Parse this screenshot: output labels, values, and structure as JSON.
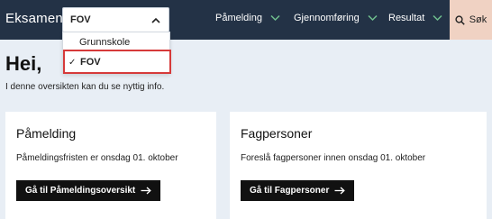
{
  "header": {
    "brand": "Eksamen",
    "select": {
      "value": "FOV"
    },
    "nav": [
      {
        "label": "Påmelding"
      },
      {
        "label": "Gjennomføring"
      },
      {
        "label": "Resultat"
      }
    ],
    "search_label": "Søk"
  },
  "dropdown": {
    "options": [
      {
        "label": "Grunnskole",
        "selected": false
      },
      {
        "label": "FOV",
        "selected": true
      }
    ],
    "check_glyph": "✓"
  },
  "hero": {
    "title": "Hei,",
    "subtitle": "I denne oversikten kan du se nyttig info."
  },
  "cards": [
    {
      "title": "Påmelding",
      "text": "Påmeldingsfristen er onsdag 01. oktober",
      "cta": "Gå til Påmeldingsoversikt"
    },
    {
      "title": "Fagpersoner",
      "text": "Foreslå fagpersoner innen onsdag 01. oktober",
      "cta": "Gå til Fagpersoner"
    }
  ],
  "colors": {
    "header_bg": "#233246",
    "accent_green": "#6fbf8e",
    "search_bg": "#f0d2c3",
    "highlight_border": "#d63a3a",
    "page_bg": "#e8eef5"
  }
}
